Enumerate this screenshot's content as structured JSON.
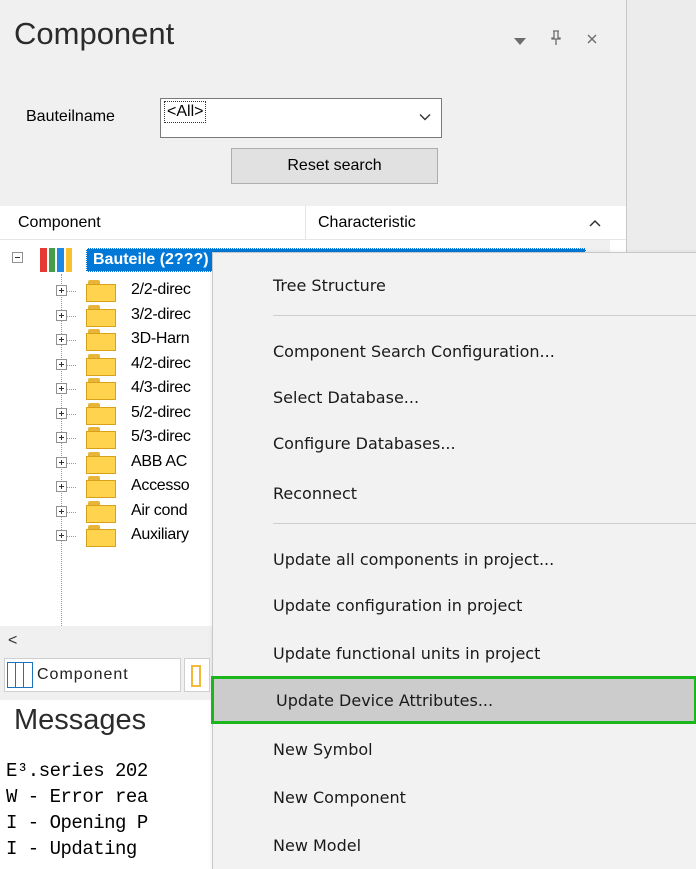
{
  "panel": {
    "title": "Component",
    "controls": {
      "dropdown_icon": "triangle-down-icon",
      "pin": "p",
      "close": "×"
    }
  },
  "filter": {
    "label": "Bauteilname",
    "value": "<All>",
    "reset_label": "Reset search"
  },
  "tree": {
    "col1": "Component",
    "col2": "Characteristic",
    "root_label": "Bauteile (2???)",
    "root_bar_colors": [
      "#e53935",
      "#43a047",
      "#1e88e5",
      "#fbc02d"
    ],
    "nodes": [
      "2/2-direc",
      "3/2-direc",
      "3D-Harn",
      "4/2-direc",
      "4/3-direc",
      "5/2-direc",
      "5/3-direc",
      "ABB AC",
      "Accesso",
      "Air cond",
      "Auxiliary"
    ]
  },
  "bottom_tabs": {
    "component_label": "Component"
  },
  "messages": {
    "title": "Messages",
    "lines": [
      "E³.series 202",
      "W - Error rea",
      "I - Opening P",
      "I - Updating "
    ]
  },
  "context_menu": {
    "items": [
      {
        "label": "Tree Structure"
      },
      {
        "label": "Component Search Configuration..."
      },
      {
        "label": "Select Database..."
      },
      {
        "label": "Configure Databases..."
      },
      {
        "label": "Reconnect"
      },
      {
        "label": "Update all components in project..."
      },
      {
        "label": "Update configuration in project"
      },
      {
        "label": "Update functional units in project"
      },
      {
        "label": "Update Device Attributes..."
      },
      {
        "label": "New Symbol"
      },
      {
        "label": "New Component"
      },
      {
        "label": "New Model"
      }
    ],
    "highlight_color": "#1bb61b"
  }
}
